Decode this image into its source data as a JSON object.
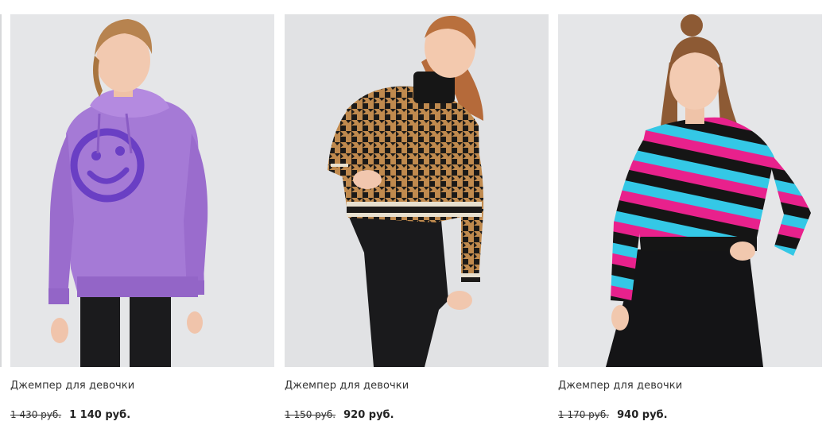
{
  "colors": {
    "photo_background": "#e5e6e8",
    "sweater_lilac": "#a57ad6",
    "houndstooth_tan": "#c08a4e",
    "stripe_pink": "#e8218c",
    "stripe_cyan": "#34c8e6"
  },
  "products": [
    {
      "title": "Джемпер для девочки",
      "old_price": "1 430 руб.",
      "price": "1 140 руб."
    },
    {
      "title": "Джемпер для девочки",
      "old_price": "1 150 руб.",
      "price": "920 руб."
    },
    {
      "title": "Джемпер для девочки",
      "old_price": "1 170 руб.",
      "price": "940 руб."
    }
  ]
}
